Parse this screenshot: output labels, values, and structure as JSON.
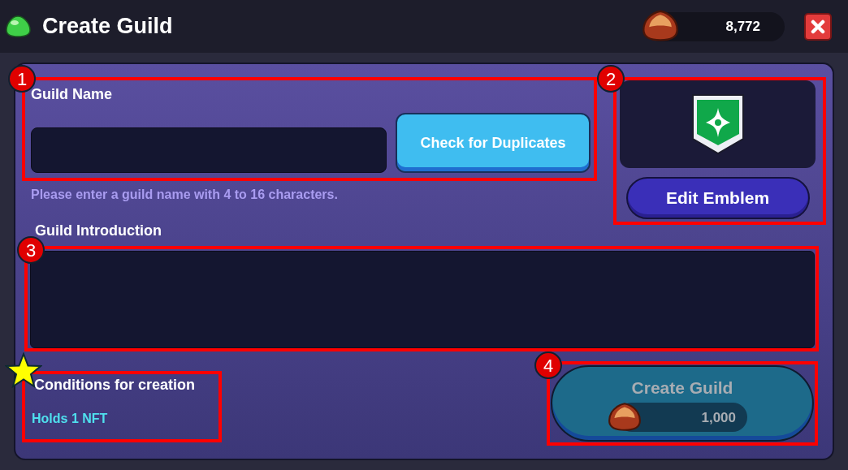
{
  "header": {
    "title": "Create Guild",
    "currency": "8,772"
  },
  "guild_name": {
    "label": "Guild Name",
    "check_button": "Check for Duplicates",
    "hint": "Please enter a guild name with 4 to 16 characters."
  },
  "emblem": {
    "edit_button": "Edit Emblem"
  },
  "introduction": {
    "label": "Guild Introduction"
  },
  "conditions": {
    "label": "Conditions for creation",
    "requirement": "Holds 1 NFT"
  },
  "create_button": {
    "label": "Create Guild",
    "cost": "1,000",
    "disabled": true
  },
  "annotations": [
    {
      "kind": "number",
      "label": "1"
    },
    {
      "kind": "number",
      "label": "2"
    },
    {
      "kind": "number",
      "label": "3"
    },
    {
      "kind": "number",
      "label": "4"
    },
    {
      "kind": "star"
    }
  ]
}
